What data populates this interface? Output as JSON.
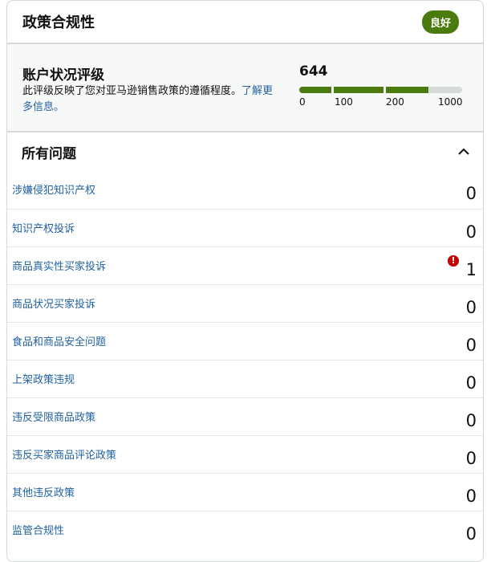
{
  "header": {
    "title": "政策合规性",
    "status_badge": "良好"
  },
  "account_health": {
    "title": "账户状况评级",
    "description": "此评级反映了您对亚马逊销售政策的遵循程度。",
    "learn_more_link": "了解更多信息。",
    "score": "644",
    "score_value": 644,
    "scale_ticks": [
      "0",
      "100",
      "200",
      "1000"
    ],
    "colors": {
      "bar_fill": "#4b7b0f",
      "bar_track": "#d5d9d9",
      "badge": "#4b7b0f"
    }
  },
  "issues": {
    "title": "所有问题",
    "collapse_icon": "chevron-up-icon",
    "items": [
      {
        "label": "涉嫌侵犯知识产权",
        "count": "0",
        "alert": false
      },
      {
        "label": "知识产权投诉",
        "count": "0",
        "alert": false
      },
      {
        "label": "商品真实性买家投诉",
        "count": "1",
        "alert": true
      },
      {
        "label": "商品状况买家投诉",
        "count": "0",
        "alert": false
      },
      {
        "label": "食品和商品安全问题",
        "count": "0",
        "alert": false
      },
      {
        "label": "上架政策违规",
        "count": "0",
        "alert": false
      },
      {
        "label": "违反受限商品政策",
        "count": "0",
        "alert": false
      },
      {
        "label": "违反买家商品评论政策",
        "count": "0",
        "alert": false
      },
      {
        "label": "其他违反政策",
        "count": "0",
        "alert": false
      },
      {
        "label": "监管合规性",
        "count": "0",
        "alert": false
      }
    ],
    "alert_icon": "exclamation-icon"
  }
}
